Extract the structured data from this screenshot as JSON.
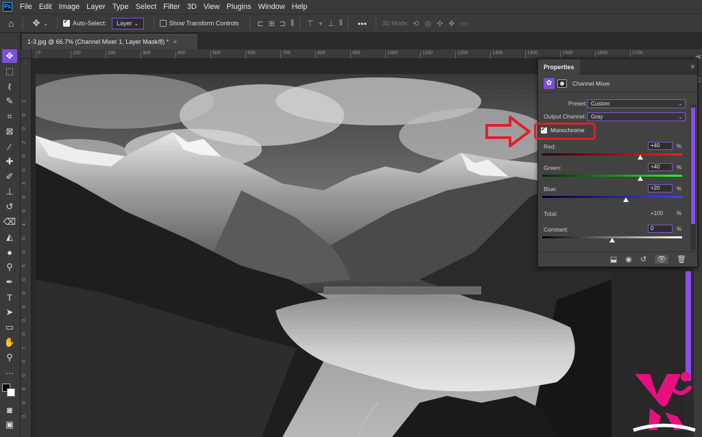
{
  "app": {
    "logo": "Ps",
    "menu": [
      "File",
      "Edit",
      "Image",
      "Layer",
      "Type",
      "Select",
      "Filter",
      "3D",
      "View",
      "Plugins",
      "Window",
      "Help"
    ]
  },
  "options_bar": {
    "auto_select_label": "Auto-Select:",
    "auto_select_value": "Layer",
    "show_transform_label": "Show Transform Controls",
    "mode_3d_label": "3D Mode:"
  },
  "document": {
    "tab_title": "1-3.jpg @ 66.7% (Channel Mixer 1, Layer Mask/8) *",
    "close_glyph": "×"
  },
  "ruler": {
    "top_ticks": [
      "0",
      "100",
      "200",
      "300",
      "400",
      "500",
      "600",
      "700",
      "800",
      "900",
      "1000",
      "1100",
      "1200",
      "1300",
      "1400",
      "1500",
      "1600",
      "1700"
    ],
    "left_ticks": [
      "1",
      "0",
      "0",
      "2",
      "0",
      "0",
      "3",
      "0",
      "0",
      "4",
      "0",
      "0",
      "5",
      "0",
      "0",
      "6",
      "0",
      "0",
      "7",
      "0",
      "0",
      "8",
      "0",
      "0"
    ]
  },
  "properties": {
    "tab_label": "Properties",
    "adjustment_title": "Channel Mixer",
    "preset_label": "Preset:",
    "preset_value": "Custom",
    "output_channel_label": "Output Channel:",
    "output_channel_value": "Gray",
    "monochrome_label": "Monochrome",
    "monochrome_checked": true,
    "red_label": "Red:",
    "red_value": "+40",
    "green_label": "Green:",
    "green_value": "+40",
    "blue_label": "Blue:",
    "blue_value": "+20",
    "total_label": "Total:",
    "total_value": "+100",
    "constant_label": "Constant:",
    "constant_value": "0",
    "percent": "%",
    "red_level": 0.7,
    "green_level": 0.7,
    "blue_level": 0.6,
    "constant_level": 0.5
  },
  "colors": {
    "accent": "#7b4fd6",
    "annotation": "#e0202a"
  }
}
